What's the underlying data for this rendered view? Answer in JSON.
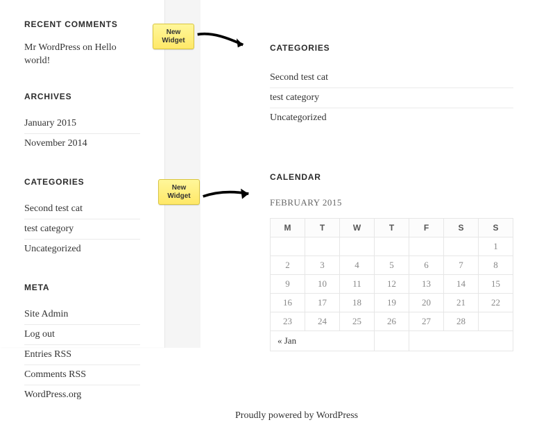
{
  "sidebar": {
    "recent_comments": {
      "title": "RECENT COMMENTS",
      "author": "Mr WordPress",
      "on_text": " on ",
      "post": "Hello world!"
    },
    "archives": {
      "title": "ARCHIVES",
      "items": [
        "January 2015",
        "November 2014"
      ]
    },
    "categories": {
      "title": "CATEGORIES",
      "items": [
        "Second test cat",
        "test category",
        "Uncategorized"
      ]
    },
    "meta": {
      "title": "META",
      "items": [
        "Site Admin",
        "Log out",
        "Entries RSS",
        "Comments RSS",
        "WordPress.org"
      ]
    }
  },
  "main": {
    "categories": {
      "title": "CATEGORIES",
      "items": [
        "Second test cat",
        "test category",
        "Uncategorized"
      ]
    },
    "calendar": {
      "title": "CALENDAR",
      "month": "FEBRUARY 2015",
      "dow": [
        "M",
        "T",
        "W",
        "T",
        "F",
        "S",
        "S"
      ],
      "weeks": [
        [
          "",
          "",
          "",
          "",
          "",
          "",
          "1"
        ],
        [
          "2",
          "3",
          "4",
          "5",
          "6",
          "7",
          "8"
        ],
        [
          "9",
          "10",
          "11",
          "12",
          "13",
          "14",
          "15"
        ],
        [
          "16",
          "17",
          "18",
          "19",
          "20",
          "21",
          "22"
        ],
        [
          "23",
          "24",
          "25",
          "26",
          "27",
          "28",
          ""
        ]
      ],
      "prev": "« Jan"
    }
  },
  "callouts": {
    "new_widget_1": "New Widget",
    "new_widget_2": "New Widget"
  },
  "footer": {
    "text": "Proudly powered by WordPress"
  }
}
